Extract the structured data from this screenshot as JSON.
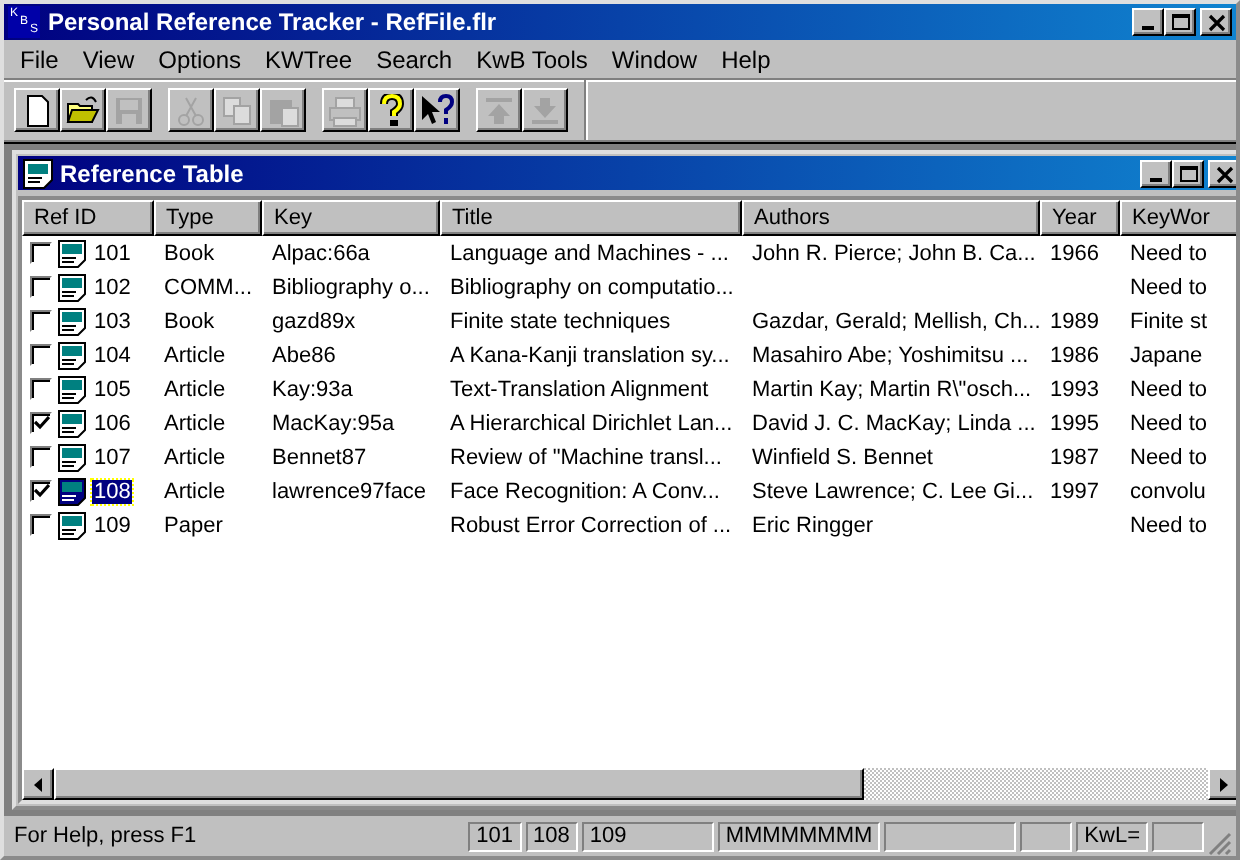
{
  "window": {
    "title": "Personal Reference Tracker - RefFile.flr",
    "logo": "KBS"
  },
  "menu": [
    {
      "label": "File"
    },
    {
      "label": "View"
    },
    {
      "label": "Options"
    },
    {
      "label": "KWTree"
    },
    {
      "label": "Search"
    },
    {
      "label": "KwB Tools"
    },
    {
      "label": "Window"
    },
    {
      "label": "Help"
    }
  ],
  "toolbar": [
    {
      "kind": "new",
      "disabled": false
    },
    {
      "kind": "open",
      "disabled": false
    },
    {
      "kind": "save",
      "disabled": true
    },
    {
      "kind": "sep"
    },
    {
      "kind": "cut",
      "disabled": true
    },
    {
      "kind": "copy",
      "disabled": true
    },
    {
      "kind": "paste",
      "disabled": true
    },
    {
      "kind": "sep"
    },
    {
      "kind": "print",
      "disabled": true
    },
    {
      "kind": "help",
      "disabled": false
    },
    {
      "kind": "context-help",
      "disabled": false
    },
    {
      "kind": "sep"
    },
    {
      "kind": "up",
      "disabled": true
    },
    {
      "kind": "down",
      "disabled": true
    }
  ],
  "child_window": {
    "title": "Reference Table"
  },
  "table": {
    "columns": [
      "Ref ID",
      "Type",
      "Key",
      "Title",
      "Authors",
      "Year",
      "KeyWor"
    ],
    "rows": [
      {
        "checked": false,
        "selected": false,
        "ref_id": "101",
        "type": "Book",
        "key": "Alpac:66a",
        "title": "Language and Machines - ...",
        "authors": "John R. Pierce; John B. Ca...",
        "year": "1966",
        "keywords": "Need to"
      },
      {
        "checked": false,
        "selected": false,
        "ref_id": "102",
        "type": "COMM...",
        "key": "Bibliography o...",
        "title": "Bibliography on computatio...",
        "keywords": "Need to"
      },
      {
        "checked": false,
        "selected": false,
        "ref_id": "103",
        "type": "Book",
        "key": "gazd89x",
        "title": "Finite state techniques",
        "authors": "Gazdar, Gerald; Mellish, Ch...",
        "year": "1989",
        "keywords": "Finite st"
      },
      {
        "checked": false,
        "selected": false,
        "ref_id": "104",
        "type": "Article",
        "key": "Abe86",
        "title": "A Kana-Kanji translation sy...",
        "authors": "Masahiro Abe; Yoshimitsu ...",
        "year": "1986",
        "keywords": "Japane"
      },
      {
        "checked": false,
        "selected": false,
        "ref_id": "105",
        "type": "Article",
        "key": "Kay:93a",
        "title": "Text-Translation Alignment",
        "authors": "Martin Kay; Martin R\\\"osch...",
        "year": "1993",
        "keywords": "Need to"
      },
      {
        "checked": true,
        "selected": false,
        "ref_id": "106",
        "type": "Article",
        "key": "MacKay:95a",
        "title": "A Hierarchical Dirichlet Lan...",
        "authors": "David J. C. MacKay; Linda ...",
        "year": "1995",
        "keywords": "Need to"
      },
      {
        "checked": false,
        "selected": false,
        "ref_id": "107",
        "type": "Article",
        "key": "Bennet87",
        "title": "Review of \"Machine transl...",
        "authors": "Winfield S. Bennet",
        "year": "1987",
        "keywords": "Need to"
      },
      {
        "checked": true,
        "selected": true,
        "ref_id": "108",
        "type": "Article",
        "key": "lawrence97face",
        "title": "Face Recognition: A Conv...",
        "authors": "Steve Lawrence; C. Lee Gi...",
        "year": "1997",
        "keywords": "convolu"
      },
      {
        "checked": false,
        "selected": false,
        "ref_id": "109",
        "type": "Paper",
        "title": "Robust Error Correction of ...",
        "authors": "Eric Ringger",
        "keywords": "Need to"
      }
    ]
  },
  "status_bar": [
    {
      "kind": "message",
      "text": "For Help, press F1"
    },
    {
      "kind": "pane",
      "text": "101"
    },
    {
      "kind": "pane",
      "text": "108"
    },
    {
      "kind": "pane",
      "text": "109"
    },
    {
      "kind": "pane",
      "text": "MMMMMMMM"
    },
    {
      "kind": "blank"
    },
    {
      "kind": "blank"
    },
    {
      "kind": "pane",
      "text": "KwL="
    },
    {
      "kind": "blank"
    }
  ]
}
